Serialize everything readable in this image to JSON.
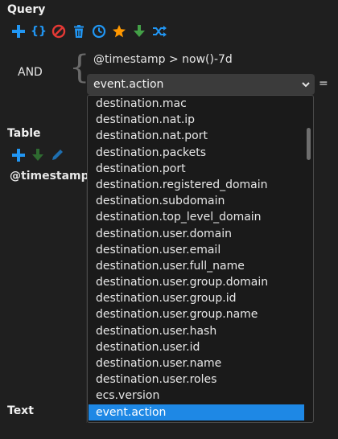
{
  "query": {
    "title": "Query",
    "toolbar": [
      {
        "name": "add-icon",
        "color": "#2196f3"
      },
      {
        "name": "braces-icon",
        "color": "#2196f3",
        "glyph": "{}"
      },
      {
        "name": "ban-icon",
        "color": "#e53935"
      },
      {
        "name": "trash-icon",
        "color": "#2196f3"
      },
      {
        "name": "clock-icon",
        "color": "#2196f3"
      },
      {
        "name": "star-icon",
        "color": "#ff9800"
      },
      {
        "name": "arrow-down-icon",
        "color": "#43a047"
      },
      {
        "name": "shuffle-icon",
        "color": "#2196f3"
      }
    ],
    "operator": "AND",
    "brace": "{",
    "condition": "@timestamp > now()-7d",
    "field_select": {
      "value": "event.action"
    },
    "comparison": "="
  },
  "table": {
    "title": "Table",
    "column_header": "@timestamp"
  },
  "text_section": {
    "title": "Text"
  },
  "dropdown": {
    "options": [
      "destination.mac",
      "destination.nat.ip",
      "destination.nat.port",
      "destination.packets",
      "destination.port",
      "destination.registered_domain",
      "destination.subdomain",
      "destination.top_level_domain",
      "destination.user.domain",
      "destination.user.email",
      "destination.user.full_name",
      "destination.user.group.domain",
      "destination.user.group.id",
      "destination.user.group.name",
      "destination.user.hash",
      "destination.user.id",
      "destination.user.name",
      "destination.user.roles",
      "ecs.version",
      "event.action"
    ],
    "selected": "event.action"
  },
  "colors": {
    "accent": "#1e88e5",
    "background": "#1f1f1f",
    "select_bg": "#3b3b3b"
  }
}
